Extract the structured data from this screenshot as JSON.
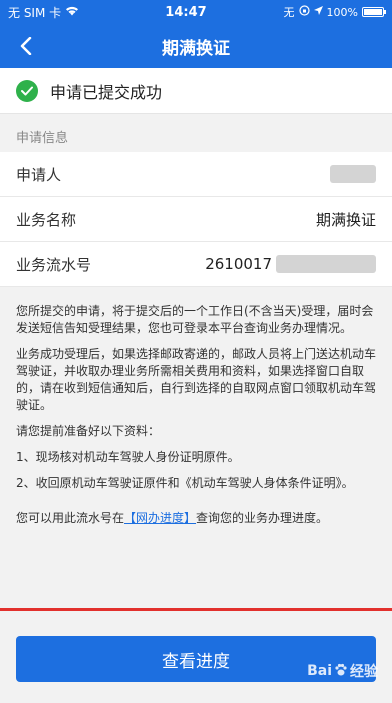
{
  "status_bar": {
    "carrier": "无 SIM 卡",
    "time": "14:47",
    "network_flag": "无",
    "battery": "100%",
    "battery_level": 1.0
  },
  "nav": {
    "title": "期满换证"
  },
  "result": {
    "message": "申请已提交成功"
  },
  "info": {
    "section_title": "申请信息",
    "rows": [
      {
        "label": "申请人",
        "value": ""
      },
      {
        "label": "业务名称",
        "value": "期满换证"
      },
      {
        "label": "业务流水号",
        "value": "2610017"
      }
    ]
  },
  "notice": {
    "p1": "您所提交的申请，将于提交后的一个工作日(不含当天)受理，届时会发送短信告知受理结果，您也可登录本平台查询业务办理情况。",
    "p2": "业务成功受理后，如果选择邮政寄递的，邮政人员将上门送达机动车驾驶证，并收取办理业务所需相关费用和资料，如果选择窗口自取的，请在收到短信通知后，自行到选择的自取网点窗口领取机动车驾驶证。",
    "p3": "请您提前准备好以下资料：",
    "p4": "1、现场核对机动车驾驶人身份证明原件。",
    "p5": "2、收回原机动车驾驶证原件和《机动车驾驶人身体条件证明》。",
    "p6_prefix": "您可以用此流水号在",
    "p6_link": "【网办进度】",
    "p6_suffix": "查询您的业务办理进度。"
  },
  "actions": {
    "progress_button": "查看进度"
  },
  "watermark": {
    "brand": "Bai",
    "brand_suffix": "经验"
  }
}
